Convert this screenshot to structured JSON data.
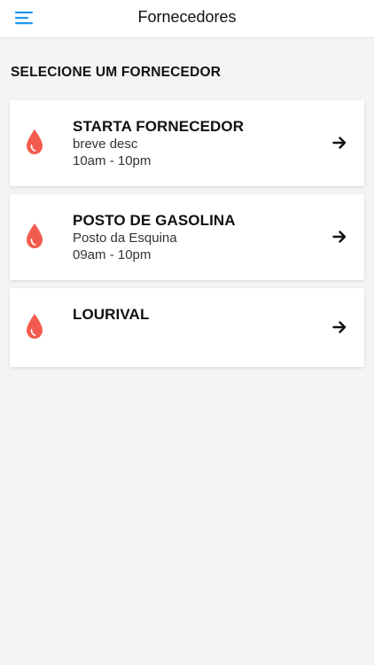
{
  "header": {
    "title": "Fornecedores",
    "menu_icon": "hamburger-menu-icon",
    "accent_color": "#2196F3"
  },
  "section": {
    "title": "SELECIONE UM FORNECEDOR"
  },
  "suppliers": [
    {
      "name": "STARTA FORNECEDOR",
      "description": "breve desc",
      "hours": "10am - 10pm",
      "icon": "drop-icon"
    },
    {
      "name": "POSTO DE GASOLINA",
      "description": "Posto da Esquina",
      "hours": "09am - 10pm",
      "icon": "drop-icon"
    },
    {
      "name": "LOURIVAL",
      "description": "",
      "hours": "",
      "icon": "drop-icon"
    }
  ],
  "colors": {
    "drop": "#F25C4F",
    "background": "#f4f4f4",
    "card": "#ffffff"
  }
}
